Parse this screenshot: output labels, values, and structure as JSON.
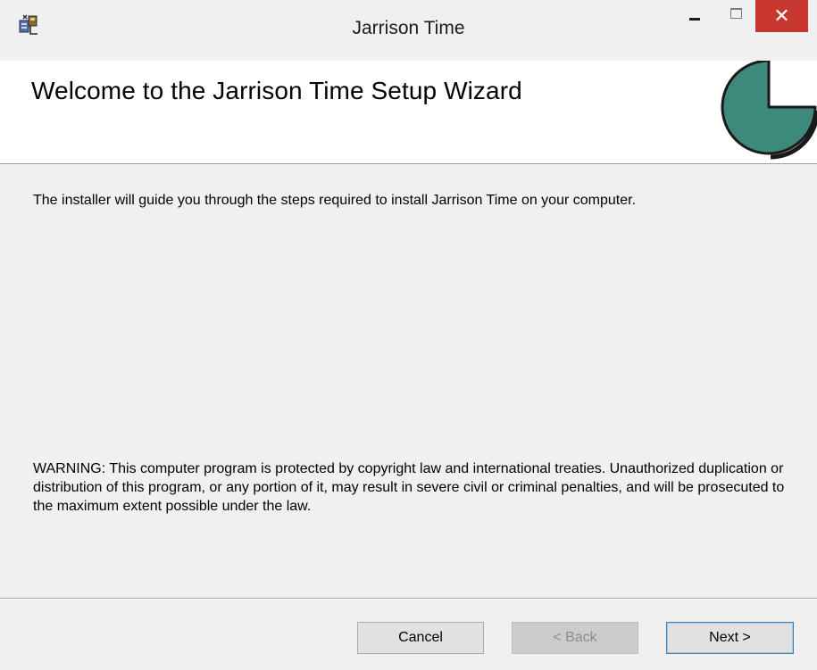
{
  "window": {
    "title": "Jarrison Time",
    "controls": {
      "minimize": "minimize",
      "maximize": "maximize",
      "close_glyph": "✕"
    },
    "app_icon": "installer-icon"
  },
  "banner": {
    "title": "Welcome to the Jarrison Time Setup Wizard",
    "logo_icon": "pie-clock-logo",
    "logo_color": "#3d8a7c"
  },
  "body": {
    "intro": "The installer will guide you through the steps required to install Jarrison Time on your computer.",
    "warning": "WARNING: This computer program is protected by copyright law and international treaties. Unauthorized duplication or distribution of this program, or any portion of it, may result in severe civil or criminal penalties, and will be prosecuted to the maximum extent possible under the law."
  },
  "buttons": {
    "cancel": "Cancel",
    "back": "< Back",
    "next": "Next >"
  },
  "colors": {
    "close_button": "#c7372f",
    "background": "#f0f0f0",
    "banner_background": "#ffffff",
    "next_border": "#3c7fb1"
  }
}
